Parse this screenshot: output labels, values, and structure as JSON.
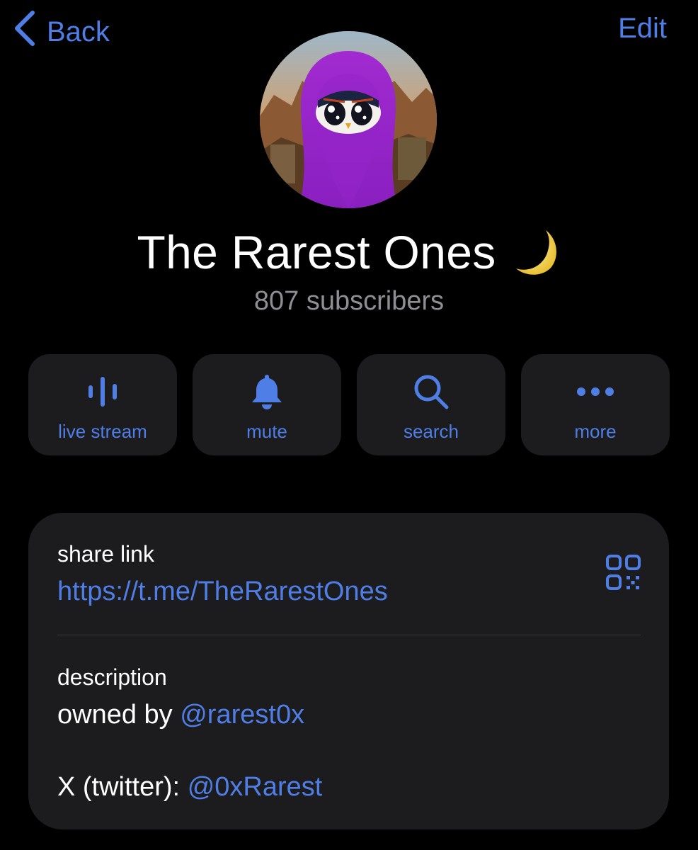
{
  "nav": {
    "back_label": "Back",
    "edit_label": "Edit"
  },
  "channel": {
    "title": "The Rarest Ones",
    "emoji": "crescent-moon",
    "subscribers": "807 subscribers"
  },
  "actions": [
    {
      "label": "live stream",
      "icon": "voice-chat-icon"
    },
    {
      "label": "mute",
      "icon": "bell-icon"
    },
    {
      "label": "search",
      "icon": "search-icon"
    },
    {
      "label": "more",
      "icon": "more-dots-icon"
    }
  ],
  "info": {
    "share_link_label": "share link",
    "share_link": "https://t.me/TheRarestOnes",
    "description_label": "description",
    "line1_prefix": "owned by ",
    "line1_mention": "@rarest0x",
    "line2_prefix": "X (twitter): ",
    "line2_mention": "@0xRarest"
  },
  "colors": {
    "accent": "#4f7fe6",
    "background": "#000000",
    "card": "#1c1c1e",
    "secondary_text": "#8e8e93"
  }
}
